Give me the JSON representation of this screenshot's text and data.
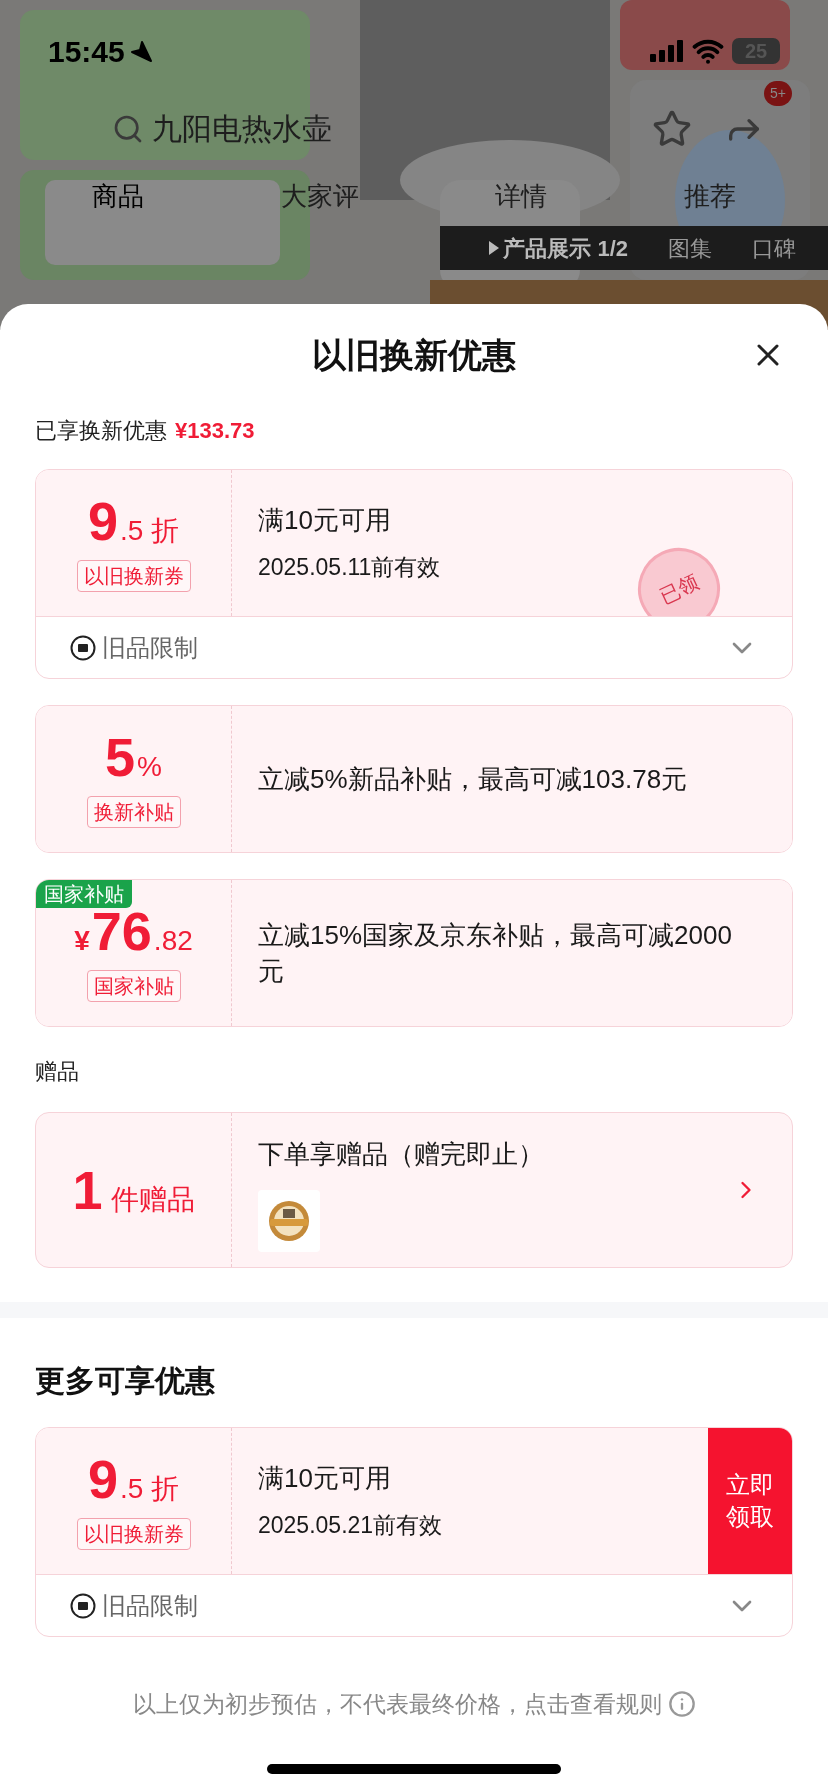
{
  "status_bar": {
    "time": "15:45",
    "battery": "25"
  },
  "product_header": {
    "search_text": "九阳电热水壶",
    "cart_badge": "5+",
    "tabs": [
      {
        "label": "商品",
        "selected": true
      },
      {
        "label": "大家评",
        "selected": false
      },
      {
        "label": "详情",
        "selected": false
      },
      {
        "label": "推荐",
        "selected": false
      }
    ],
    "media_tabs": [
      {
        "label": "产品展示 1/2",
        "selected": true
      },
      {
        "label": "图集",
        "selected": false
      },
      {
        "label": "口碑",
        "selected": false
      }
    ]
  },
  "sheet": {
    "title": "以旧换新优惠",
    "enjoyed_label": "已享换新优惠",
    "enjoyed_amount": "¥133.73",
    "offers": [
      {
        "kind": "coupon",
        "major": "9",
        "minor": ".5 折",
        "tag": "以旧换新券",
        "title": "满10元可用",
        "subtitle": "2025.05.11前有效",
        "restriction": "旧品限制",
        "claimed": true,
        "stamp": "已领"
      },
      {
        "kind": "subsidy",
        "major": "5",
        "minor": "%",
        "tag": "换新补贴",
        "title": "立减5%新品补贴，最高可减103.78元"
      },
      {
        "kind": "subsidy",
        "ribbon": "国家补贴",
        "prefix": "¥",
        "major": "76",
        "minor": ".82",
        "tag": "国家补贴",
        "title": "立减15%国家及京东补贴，最高可减2000元"
      }
    ],
    "gifts_label": "赠品",
    "gift": {
      "major": "1",
      "minor": "件赠品",
      "title": "下单享赠品（赠完即止）"
    },
    "more_title": "更多可享优惠",
    "more_offers": [
      {
        "kind": "coupon",
        "major": "9",
        "minor": ".5 折",
        "tag": "以旧换新券",
        "title": "满10元可用",
        "subtitle": "2025.05.21前有效",
        "restriction": "旧品限制",
        "claimed": false,
        "claim_button": "立即领取"
      }
    ],
    "footer_note": "以上仅为初步预估，不代表最终价格，点击查看规则"
  }
}
